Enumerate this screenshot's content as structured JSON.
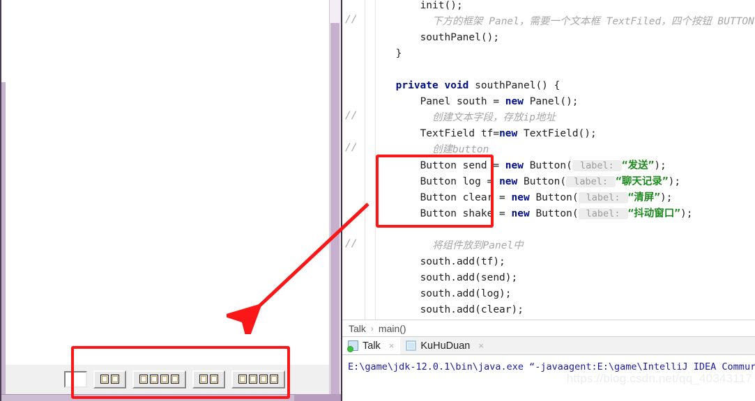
{
  "gui_window": {
    "name": "Talk chat client window",
    "south_panel": {
      "textfield": {
        "value": "",
        "placeholder": ""
      },
      "buttons": [
        {
          "name": "send-button",
          "label": "发送",
          "glyph_boxes": 2,
          "rendered_as": "missing-glyph-boxes"
        },
        {
          "name": "log-button",
          "label": "聊天记录",
          "glyph_boxes": 4,
          "rendered_as": "missing-glyph-boxes"
        },
        {
          "name": "clear-button",
          "label": "清屏",
          "glyph_boxes": 2,
          "rendered_as": "missing-glyph-boxes"
        },
        {
          "name": "shake-button",
          "label": "抖动窗口",
          "glyph_boxes": 4,
          "rendered_as": "missing-glyph-boxes"
        }
      ]
    }
  },
  "editor": {
    "lines": [
      {
        "indent": 9,
        "comment_marker": "",
        "segments": [
          {
            "t": "init();",
            "c": "plain"
          }
        ]
      },
      {
        "indent": 11,
        "comment_marker": "//",
        "segments": [
          {
            "t": "下方的框架 Panel，需要一个文本框 TextFiled，四个按钮 BUTTON",
            "c": "cmt"
          }
        ]
      },
      {
        "indent": 9,
        "comment_marker": "",
        "segments": [
          {
            "t": "southPanel();",
            "c": "plain"
          }
        ]
      },
      {
        "indent": 5,
        "comment_marker": "",
        "segments": [
          {
            "t": "}",
            "c": "plain"
          }
        ]
      },
      {
        "indent": 0,
        "comment_marker": "",
        "segments": []
      },
      {
        "indent": 5,
        "comment_marker": "",
        "segments": [
          {
            "t": "private void ",
            "c": "kw"
          },
          {
            "t": "southPanel() {",
            "c": "plain"
          }
        ]
      },
      {
        "indent": 9,
        "comment_marker": "",
        "segments": [
          {
            "t": "Panel south = ",
            "c": "plain"
          },
          {
            "t": "new ",
            "c": "kw"
          },
          {
            "t": "Panel();",
            "c": "plain"
          }
        ]
      },
      {
        "indent": 11,
        "comment_marker": "//",
        "segments": [
          {
            "t": "创建文本字段，存放ip地址",
            "c": "cmt"
          }
        ]
      },
      {
        "indent": 9,
        "comment_marker": "",
        "segments": [
          {
            "t": "TextField tf=",
            "c": "plain"
          },
          {
            "t": "new ",
            "c": "kw"
          },
          {
            "t": "TextField();",
            "c": "plain"
          }
        ]
      },
      {
        "indent": 11,
        "comment_marker": "//",
        "segments": [
          {
            "t": "创建button",
            "c": "cmt"
          }
        ]
      },
      {
        "indent": 9,
        "comment_marker": "",
        "segments": [
          {
            "t": "Button send = ",
            "c": "plain"
          },
          {
            "t": "new ",
            "c": "kw"
          },
          {
            "t": "Button(",
            "c": "plain"
          },
          {
            "t": " label: ",
            "c": "hint"
          },
          {
            "t": "“发送”",
            "c": "str"
          },
          {
            "t": ");",
            "c": "plain"
          }
        ]
      },
      {
        "indent": 9,
        "comment_marker": "",
        "segments": [
          {
            "t": "Button log = ",
            "c": "plain"
          },
          {
            "t": "new ",
            "c": "kw"
          },
          {
            "t": "Button(",
            "c": "plain"
          },
          {
            "t": " label: ",
            "c": "hint"
          },
          {
            "t": "“聊天记录”",
            "c": "str"
          },
          {
            "t": ");",
            "c": "plain"
          }
        ]
      },
      {
        "indent": 9,
        "comment_marker": "",
        "segments": [
          {
            "t": "Button clear = ",
            "c": "plain"
          },
          {
            "t": "new ",
            "c": "kw"
          },
          {
            "t": "Button(",
            "c": "plain"
          },
          {
            "t": " label: ",
            "c": "hint"
          },
          {
            "t": "“清屏”",
            "c": "str"
          },
          {
            "t": ");",
            "c": "plain"
          }
        ]
      },
      {
        "indent": 9,
        "comment_marker": "",
        "segments": [
          {
            "t": "Button shake = ",
            "c": "plain"
          },
          {
            "t": "new ",
            "c": "kw"
          },
          {
            "t": "Button(",
            "c": "plain"
          },
          {
            "t": " label: ",
            "c": "hint"
          },
          {
            "t": "“抖动窗口”",
            "c": "str"
          },
          {
            "t": ");",
            "c": "plain"
          }
        ]
      },
      {
        "indent": 0,
        "comment_marker": "",
        "segments": []
      },
      {
        "indent": 11,
        "comment_marker": "//",
        "segments": [
          {
            "t": "将组件放到Panel中",
            "c": "cmt"
          }
        ]
      },
      {
        "indent": 9,
        "comment_marker": "",
        "segments": [
          {
            "t": "south.add(tf);",
            "c": "plain"
          }
        ]
      },
      {
        "indent": 9,
        "comment_marker": "",
        "segments": [
          {
            "t": "south.add(send);",
            "c": "plain"
          }
        ]
      },
      {
        "indent": 9,
        "comment_marker": "",
        "segments": [
          {
            "t": "south.add(log);",
            "c": "plain"
          }
        ]
      },
      {
        "indent": 9,
        "comment_marker": "",
        "segments": [
          {
            "t": "south.add(clear);",
            "c": "plain"
          }
        ]
      }
    ]
  },
  "breadcrumb": {
    "class_name": "Talk",
    "separator": "›",
    "method_name": "main()"
  },
  "run_tabs": [
    {
      "label": "Talk",
      "icon": "run-app-icon",
      "close": "×",
      "active": true
    },
    {
      "label": "KuHuDuan",
      "icon": "window-icon",
      "close": "×",
      "active": false
    }
  ],
  "console": {
    "line": "E:\\game\\jdk-12.0.1\\bin\\java.exe “-javaagent:E:\\game\\IntelliJ IDEA Commur"
  },
  "watermark": "https://blog.csdn.net/qq_40343117",
  "annotations": {
    "color": "#fb1717",
    "box_code_label": "highlighted button declarations",
    "box_gui_label": "highlighted rendered buttons",
    "arrow_label": "code-to-result arrow"
  }
}
